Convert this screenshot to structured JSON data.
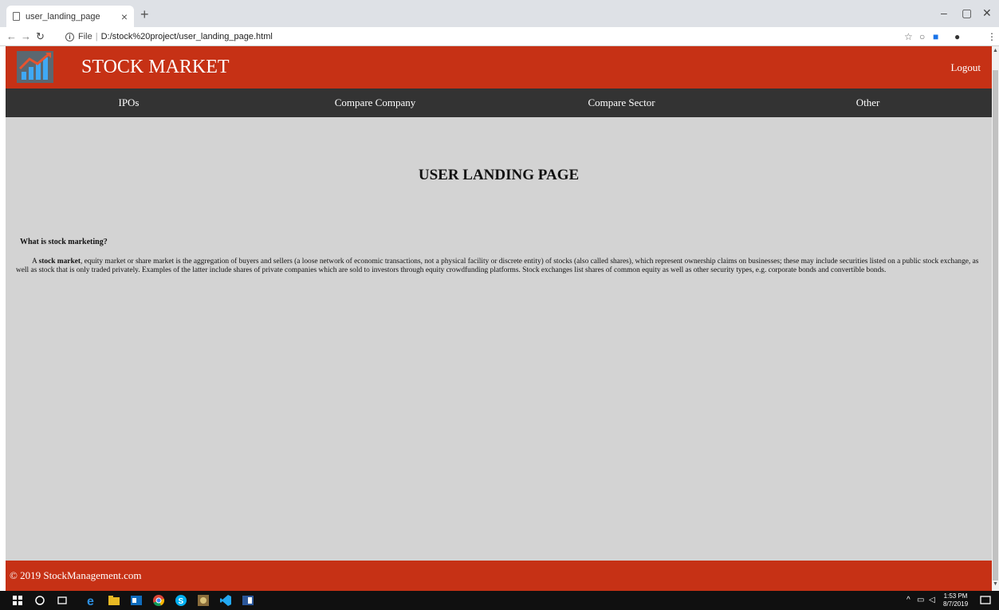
{
  "browser": {
    "tab_title": "user_landing_page",
    "tab_close": "×",
    "new_tab": "+",
    "url_scheme": "File",
    "url": "D:/stock%20project/user_landing_page.html",
    "window_controls": [
      "–",
      "▢",
      "✕"
    ]
  },
  "header": {
    "site_title": "STOCK MARKET",
    "logout_label": "Logout",
    "accent_color": "#c63115"
  },
  "nav": {
    "items": [
      {
        "label": "IPOs"
      },
      {
        "label": "Compare Company"
      },
      {
        "label": "Compare Sector"
      },
      {
        "label": "Other"
      }
    ]
  },
  "main": {
    "heading": "USER LANDING PAGE",
    "question": "What is stock marketing?",
    "para_lead": "A ",
    "para_bold": "stock market",
    "para_rest": ", equity market or share market is the aggregation of buyers and sellers (a loose network of economic transactions, not a physical facility or discrete entity) of stocks (also called shares), which represent ownership claims on businesses; these may include securities listed on a public stock exchange, as well as stock that is only traded privately. Examples of the latter include shares of private companies which are sold to investors through equity crowdfunding platforms. Stock exchanges list shares of common equity as well as other security types, e.g. corporate bonds and convertible bonds."
  },
  "footer": {
    "copyright": "© 2019 StockManagement.com"
  },
  "taskbar": {
    "time": "1:53 PM",
    "date": "8/7/2019"
  }
}
